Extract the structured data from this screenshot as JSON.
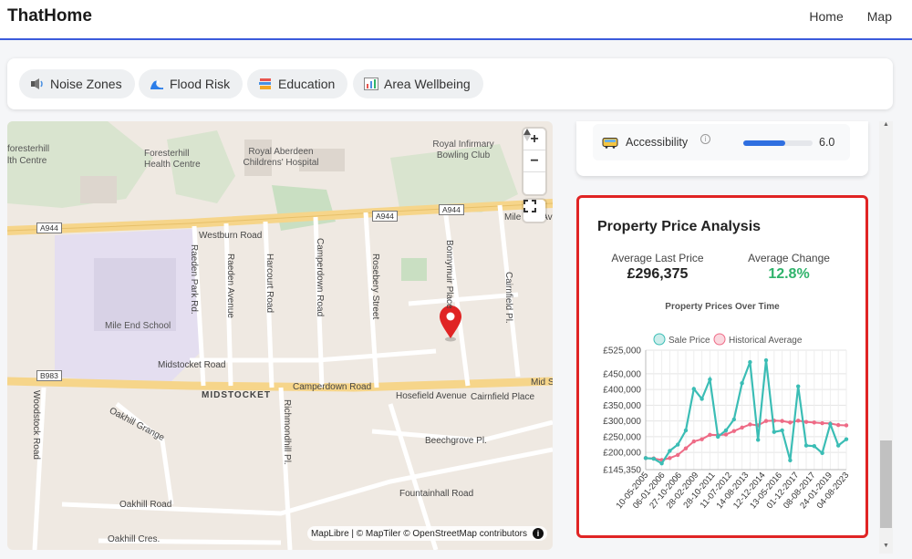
{
  "header": {
    "brand": "ThatHome",
    "nav": [
      "Home",
      "Map"
    ]
  },
  "chips": [
    {
      "label": "Noise Zones",
      "icon": "speaker-icon"
    },
    {
      "label": "Flood Risk",
      "icon": "wave-icon"
    },
    {
      "label": "Education",
      "icon": "books-icon"
    },
    {
      "label": "Area Wellbeing",
      "icon": "bar-chart-icon"
    }
  ],
  "map": {
    "labels": [
      "Foresterhill Health Centre",
      "Royal Aberdeen Childrens' Hospital",
      "Royal Infirmary Bowling Club",
      "Mile End School",
      "Midstocket Road",
      "MIDSTOCKET",
      "Camperdown Road",
      "Hosefield Avenue",
      "Cairnfield Place",
      "Beechgrove Pl.",
      "Oakhill Grange",
      "Oakhill Road",
      "Oakhill Cres.",
      "Fountainhall Road",
      "Westburn Road",
      "Raeden Park Rd.",
      "Raeden Avenue",
      "Harcourt Road",
      "Camperdown Road",
      "Rosebery Street",
      "Bonnymuir Place",
      "Cairnfield Pl.",
      "Woodstock Road",
      "Richmondhill Pl.",
      "Mile End Av",
      "Mid St",
      "foresterhill",
      "lth Centre"
    ],
    "shields": [
      "A944",
      "A944",
      "A944",
      "B983"
    ],
    "attribution": "MapLibre | © MapTiler © OpenStreetMap contributors",
    "zoom_in": "+",
    "zoom_out": "−"
  },
  "accessibility": {
    "label": "Accessibility",
    "value": "6.0",
    "score_fraction": 0.6
  },
  "price_analysis": {
    "title": "Property Price Analysis",
    "avg_last_price_label": "Average Last Price",
    "avg_last_price": "£296,375",
    "avg_change_label": "Average Change",
    "avg_change": "12.8%",
    "change_color": "#2fb36b"
  },
  "chart_data": {
    "type": "line",
    "title": "Property Prices Over Time",
    "legend": [
      "Sale Price",
      "Historical Average"
    ],
    "y_ticks": [
      "£525,000",
      "£450,000",
      "£400,000",
      "£350,000",
      "£300,000",
      "£250,000",
      "£200,000",
      "£145,350"
    ],
    "y_tick_values": [
      525000,
      450000,
      400000,
      350000,
      300000,
      250000,
      200000,
      145350
    ],
    "ylim": [
      145350,
      525000
    ],
    "x_tick_labels": [
      "10-05-2005",
      "06-01-2006",
      "27-10-2006",
      "28-02-2009",
      "28-10-2011",
      "11-07-2012",
      "14-08-2013",
      "12-12-2014",
      "13-05-2016",
      "01-12-2017",
      "08-08-2017",
      "24-01-2019",
      "04-08-2023"
    ],
    "series": [
      {
        "name": "Sale Price",
        "color": "#3bbdb5",
        "values": [
          182000,
          180000,
          165000,
          205000,
          225000,
          270000,
          402000,
          370000,
          432000,
          250000,
          270000,
          305000,
          420000,
          487000,
          240000,
          493000,
          265000,
          270000,
          175000,
          410000,
          222000,
          220000,
          198000,
          290000,
          222000,
          242000
        ]
      },
      {
        "name": "Historical Average",
        "color": "#ee6b86",
        "values": [
          182000,
          181000,
          176000,
          182000,
          192000,
          213000,
          235000,
          242000,
          256000,
          255000,
          257000,
          268000,
          279000,
          289000,
          286000,
          300000,
          301000,
          300000,
          295000,
          301000,
          297000,
          295000,
          293000,
          292000,
          287000,
          286000
        ]
      }
    ],
    "x_count": 26
  }
}
